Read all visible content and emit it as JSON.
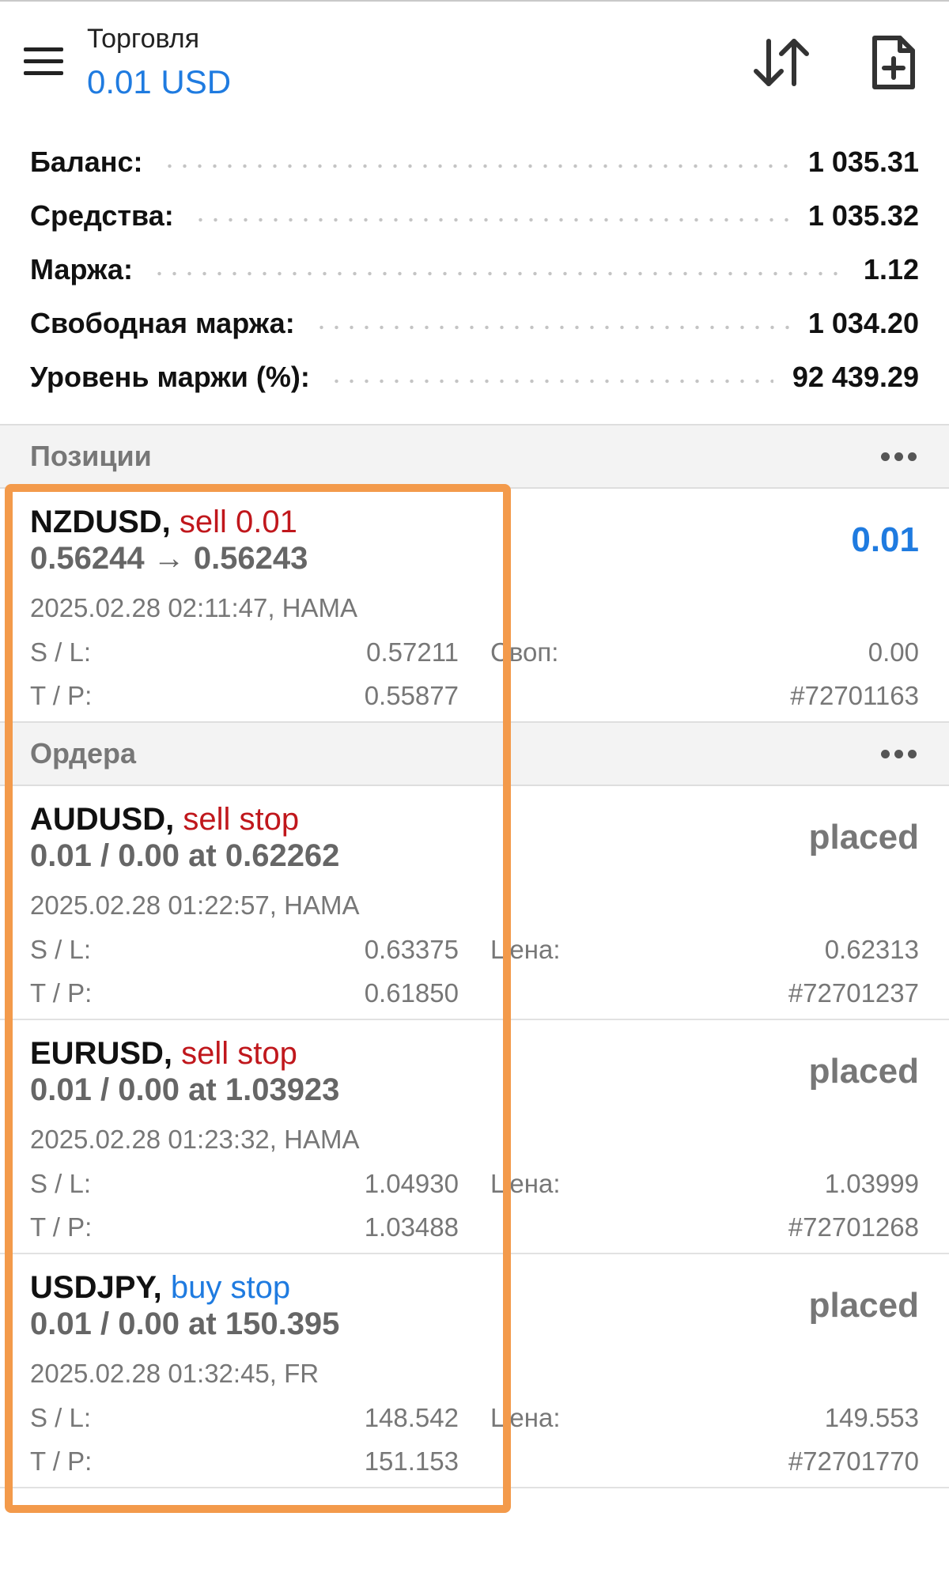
{
  "header": {
    "title": "Торговля",
    "subtitle": "0.01 USD"
  },
  "colors": {
    "accent": "#1f7be0",
    "sell": "#c0171c",
    "highlight": "#f39a4b"
  },
  "summary": {
    "rows": [
      {
        "label": "Баланс:",
        "value": "1 035.31"
      },
      {
        "label": "Средства:",
        "value": "1 035.32"
      },
      {
        "label": "Маржа:",
        "value": "1.12"
      },
      {
        "label": "Свободная маржа:",
        "value": "1 034.20"
      },
      {
        "label": "Уровень маржи (%):",
        "value": "92 439.29"
      }
    ]
  },
  "positions": {
    "title": "Позиции",
    "items": [
      {
        "symbol": "NZDUSD,",
        "side": "sell 0.01",
        "prices": "0.56244 → 0.56243",
        "time": "2025.02.28 02:11:47, НАМА",
        "profit": "0.01",
        "sl_label": "S / L:",
        "sl": "0.57211",
        "tp_label": "T / P:",
        "tp": "0.55877",
        "right_label": "Своп:",
        "right_value": "0.00",
        "ticket": "#72701163"
      }
    ]
  },
  "orders": {
    "title": "Ордера",
    "items": [
      {
        "symbol": "AUDUSD,",
        "side": "sell stop",
        "side_type": "sell",
        "volume": "0.01 / 0.00 at 0.62262",
        "time": "2025.02.28 01:22:57, НАМА",
        "status": "placed",
        "sl_label": "S / L:",
        "sl": "0.63375",
        "tp_label": "T / P:",
        "tp": "0.61850",
        "price_label": "Цена:",
        "price": "0.62313",
        "ticket": "#72701237"
      },
      {
        "symbol": "EURUSD,",
        "side": "sell stop",
        "side_type": "sell",
        "volume": "0.01 / 0.00 at 1.03923",
        "time": "2025.02.28 01:23:32, НАМА",
        "status": "placed",
        "sl_label": "S / L:",
        "sl": "1.04930",
        "tp_label": "T / P:",
        "tp": "1.03488",
        "price_label": "Цена:",
        "price": "1.03999",
        "ticket": "#72701268"
      },
      {
        "symbol": "USDJPY,",
        "side": "buy stop",
        "side_type": "buy",
        "volume": "0.01 / 0.00 at 150.395",
        "time": "2025.02.28 01:32:45, FR",
        "status": "placed",
        "sl_label": "S / L:",
        "sl": "148.542",
        "tp_label": "T / P:",
        "tp": "151.153",
        "price_label": "Цена:",
        "price": "149.553",
        "ticket": "#72701770"
      }
    ]
  }
}
